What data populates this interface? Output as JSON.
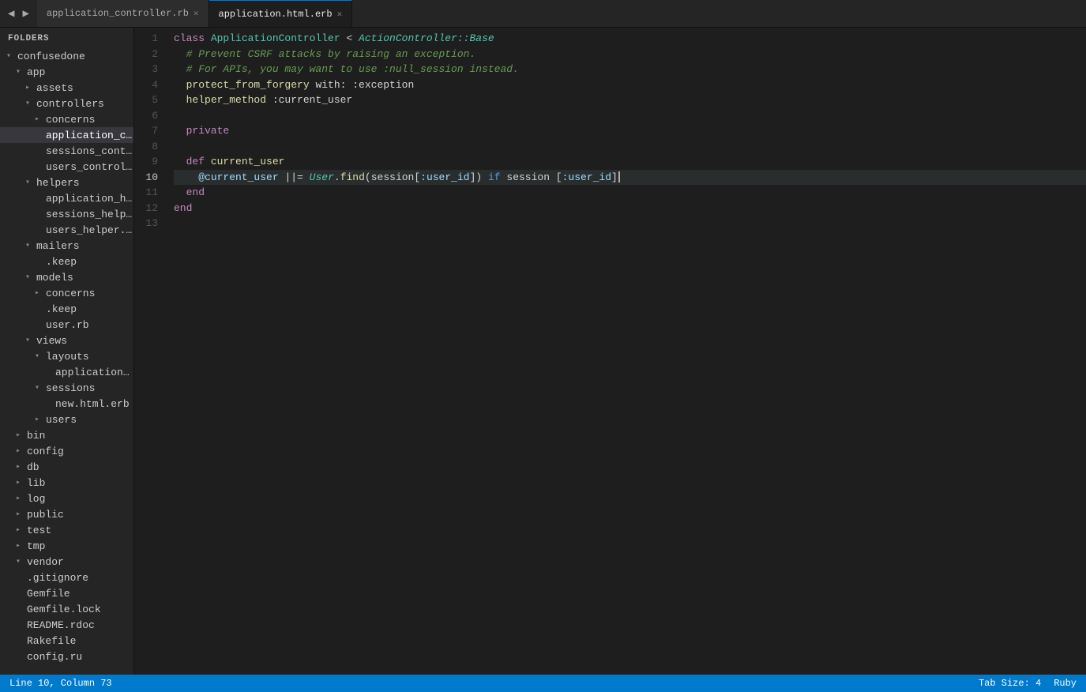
{
  "header": {
    "nav_back": "◀",
    "nav_forward": "▶",
    "tabs": [
      {
        "id": "tab-rb",
        "label": "application_controller.rb",
        "active": false,
        "close": "✕"
      },
      {
        "id": "tab-erb",
        "label": "application.html.erb",
        "active": true,
        "close": "✕"
      }
    ]
  },
  "sidebar": {
    "header": "FOLDERS",
    "items": [
      {
        "id": "confusedone",
        "label": "confusedone",
        "indent": 0,
        "arrow": "down",
        "type": "folder"
      },
      {
        "id": "app",
        "label": "app",
        "indent": 1,
        "arrow": "down",
        "type": "folder"
      },
      {
        "id": "assets",
        "label": "assets",
        "indent": 2,
        "arrow": "right",
        "type": "folder"
      },
      {
        "id": "controllers",
        "label": "controllers",
        "indent": 2,
        "arrow": "down",
        "type": "folder"
      },
      {
        "id": "concerns-ctrl",
        "label": "concerns",
        "indent": 3,
        "arrow": "right",
        "type": "folder"
      },
      {
        "id": "application_controller",
        "label": "application_controller",
        "indent": 3,
        "arrow": "none",
        "type": "file",
        "selected": true
      },
      {
        "id": "sessions_controller",
        "label": "sessions_controller.",
        "indent": 3,
        "arrow": "none",
        "type": "file"
      },
      {
        "id": "users_controller",
        "label": "users_controller.rb",
        "indent": 3,
        "arrow": "none",
        "type": "file"
      },
      {
        "id": "helpers",
        "label": "helpers",
        "indent": 2,
        "arrow": "down",
        "type": "folder"
      },
      {
        "id": "application_helper",
        "label": "application_helper.",
        "indent": 3,
        "arrow": "none",
        "type": "file"
      },
      {
        "id": "sessions_helper",
        "label": "sessions_helper.rb",
        "indent": 3,
        "arrow": "none",
        "type": "file"
      },
      {
        "id": "users_helper",
        "label": "users_helper.rb",
        "indent": 3,
        "arrow": "none",
        "type": "file"
      },
      {
        "id": "mailers",
        "label": "mailers",
        "indent": 2,
        "arrow": "down",
        "type": "folder"
      },
      {
        "id": "keep-mailers",
        "label": ".keep",
        "indent": 3,
        "arrow": "none",
        "type": "file"
      },
      {
        "id": "models",
        "label": "models",
        "indent": 2,
        "arrow": "down",
        "type": "folder"
      },
      {
        "id": "concerns-models",
        "label": "concerns",
        "indent": 3,
        "arrow": "right",
        "type": "folder"
      },
      {
        "id": "keep-models",
        "label": ".keep",
        "indent": 3,
        "arrow": "none",
        "type": "file"
      },
      {
        "id": "user-rb",
        "label": "user.rb",
        "indent": 3,
        "arrow": "none",
        "type": "file"
      },
      {
        "id": "views",
        "label": "views",
        "indent": 2,
        "arrow": "down",
        "type": "folder"
      },
      {
        "id": "layouts",
        "label": "layouts",
        "indent": 3,
        "arrow": "down",
        "type": "folder"
      },
      {
        "id": "application-html",
        "label": "application.html.",
        "indent": 4,
        "arrow": "none",
        "type": "file"
      },
      {
        "id": "sessions",
        "label": "sessions",
        "indent": 3,
        "arrow": "down",
        "type": "folder"
      },
      {
        "id": "new-html-erb",
        "label": "new.html.erb",
        "indent": 4,
        "arrow": "none",
        "type": "file"
      },
      {
        "id": "users",
        "label": "users",
        "indent": 3,
        "arrow": "right",
        "type": "folder"
      },
      {
        "id": "bin",
        "label": "bin",
        "indent": 1,
        "arrow": "right",
        "type": "folder"
      },
      {
        "id": "config",
        "label": "config",
        "indent": 1,
        "arrow": "right",
        "type": "folder"
      },
      {
        "id": "db",
        "label": "db",
        "indent": 1,
        "arrow": "right",
        "type": "folder"
      },
      {
        "id": "lib",
        "label": "lib",
        "indent": 1,
        "arrow": "right",
        "type": "folder"
      },
      {
        "id": "log",
        "label": "log",
        "indent": 1,
        "arrow": "right",
        "type": "folder"
      },
      {
        "id": "public",
        "label": "public",
        "indent": 1,
        "arrow": "right",
        "type": "folder"
      },
      {
        "id": "test",
        "label": "test",
        "indent": 1,
        "arrow": "right",
        "type": "folder"
      },
      {
        "id": "tmp",
        "label": "tmp",
        "indent": 1,
        "arrow": "right",
        "type": "folder"
      },
      {
        "id": "vendor",
        "label": "vendor",
        "indent": 1,
        "arrow": "down",
        "type": "folder"
      },
      {
        "id": "gitignore",
        "label": ".gitignore",
        "indent": 1,
        "arrow": "none",
        "type": "file"
      },
      {
        "id": "gemfile",
        "label": "Gemfile",
        "indent": 1,
        "arrow": "none",
        "type": "file"
      },
      {
        "id": "gemfile-lock",
        "label": "Gemfile.lock",
        "indent": 1,
        "arrow": "none",
        "type": "file"
      },
      {
        "id": "readme",
        "label": "README.rdoc",
        "indent": 1,
        "arrow": "none",
        "type": "file"
      },
      {
        "id": "rakefile",
        "label": "Rakefile",
        "indent": 1,
        "arrow": "none",
        "type": "file"
      },
      {
        "id": "config-ru",
        "label": "config.ru",
        "indent": 1,
        "arrow": "none",
        "type": "file"
      }
    ]
  },
  "editor": {
    "active_tab": "application_controller.rb",
    "current_line": 10,
    "lines": [
      {
        "n": 1,
        "tokens": [
          {
            "t": "kw",
            "v": "class "
          },
          {
            "t": "class-name",
            "v": "ApplicationController"
          },
          {
            "t": "plain",
            "v": " < "
          },
          {
            "t": "italic-class",
            "v": "ActionController::Base"
          }
        ]
      },
      {
        "n": 2,
        "tokens": [
          {
            "t": "comment",
            "v": "  # Prevent CSRF attacks by raising an exception."
          }
        ]
      },
      {
        "n": 3,
        "tokens": [
          {
            "t": "comment",
            "v": "  # For APIs, you may want to use :null_session instead."
          }
        ]
      },
      {
        "n": 4,
        "tokens": [
          {
            "t": "plain",
            "v": "  "
          },
          {
            "t": "method-call",
            "v": "protect_from_forgery"
          },
          {
            "t": "plain",
            "v": " with: :exception"
          }
        ]
      },
      {
        "n": 5,
        "tokens": [
          {
            "t": "plain",
            "v": "  "
          },
          {
            "t": "method-call",
            "v": "helper_method"
          },
          {
            "t": "plain",
            "v": " :current_user"
          }
        ]
      },
      {
        "n": 6,
        "tokens": []
      },
      {
        "n": 7,
        "tokens": [
          {
            "t": "kw",
            "v": "  private"
          }
        ]
      },
      {
        "n": 8,
        "tokens": []
      },
      {
        "n": 9,
        "tokens": [
          {
            "t": "kw",
            "v": "  def "
          },
          {
            "t": "method-call",
            "v": "current_user"
          }
        ]
      },
      {
        "n": 10,
        "tokens": [
          {
            "t": "plain",
            "v": "    "
          },
          {
            "t": "ivar",
            "v": "@current_user"
          },
          {
            "t": "plain",
            "v": " "
          },
          {
            "t": "operator",
            "v": "||="
          },
          {
            "t": "plain",
            "v": " "
          },
          {
            "t": "italic-class",
            "v": "User"
          },
          {
            "t": "plain",
            "v": "."
          },
          {
            "t": "method-call",
            "v": "find"
          },
          {
            "t": "plain",
            "v": "("
          },
          {
            "t": "plain",
            "v": "session"
          },
          {
            "t": "plain",
            "v": "["
          },
          {
            "t": "symbol",
            "v": ":user_id"
          },
          {
            "t": "plain",
            "v": "]) "
          },
          {
            "t": "kw-blue",
            "v": "if"
          },
          {
            "t": "plain",
            "v": " session ["
          },
          {
            "t": "symbol",
            "v": ":user_id"
          },
          {
            "t": "plain",
            "v": "]"
          }
        ],
        "current": true
      },
      {
        "n": 11,
        "tokens": [
          {
            "t": "kw",
            "v": "  end"
          }
        ]
      },
      {
        "n": 12,
        "tokens": [
          {
            "t": "kw",
            "v": "end"
          }
        ]
      },
      {
        "n": 13,
        "tokens": []
      }
    ]
  },
  "status_bar": {
    "position": "Line 10, Column 73",
    "tab_size": "Tab Size: 4",
    "language": "Ruby"
  }
}
